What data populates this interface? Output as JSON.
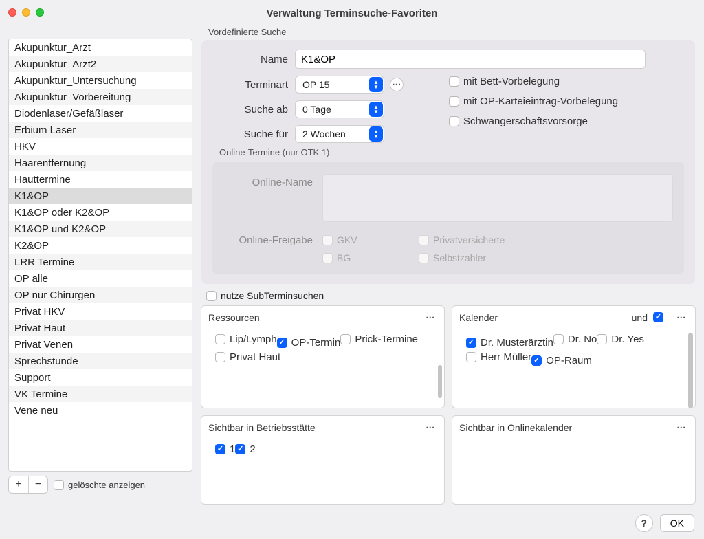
{
  "window": {
    "title": "Verwaltung Terminsuche-Favoriten"
  },
  "sidebar": {
    "items": [
      "Akupunktur_Arzt",
      "Akupunktur_Arzt2",
      "Akupunktur_Untersuchung",
      "Akupunktur_Vorbereitung",
      "Diodenlaser/Gefäßlaser",
      "Erbium Laser",
      "HKV",
      "Haarentfernung",
      "Hauttermine",
      "K1&OP",
      "K1&OP oder K2&OP",
      "K1&OP und K2&OP",
      "K2&OP",
      "LRR Termine",
      "OP alle",
      "OP nur Chirurgen",
      "Privat HKV",
      "Privat Haut",
      "Privat Venen",
      "Sprechstunde",
      "Support",
      "VK Termine",
      "Vene neu"
    ],
    "selected_index": 9,
    "add_label": "+",
    "remove_label": "−",
    "show_deleted_label": "gelöschte anzeigen"
  },
  "predef": {
    "section_title": "Vordefinierte Suche",
    "labels": {
      "name": "Name",
      "terminart": "Terminart",
      "suche_ab": "Suche ab",
      "suche_fuer": "Suche für"
    },
    "values": {
      "name": "K1&OP",
      "terminart": "OP 15",
      "suche_ab": "0 Tage",
      "suche_fuer": "2 Wochen"
    },
    "checks": {
      "bett": "mit Bett-Vorbelegung",
      "opkartei": "mit OP-Karteieintrag-Vorbelegung",
      "schwanger": "Schwangerschaftsvorsorge"
    }
  },
  "online": {
    "section_title": "Online-Termine (nur OTK 1)",
    "labels": {
      "online_name": "Online-Name",
      "online_freigabe": "Online-Freigabe"
    },
    "freigabe_options": {
      "gkv": "GKV",
      "privat": "Privatversicherte",
      "bg": "BG",
      "selbst": "Selbstzahler"
    }
  },
  "subcheck_label": "nutze SubTerminsuchen",
  "panels": {
    "ressourcen": {
      "title": "Ressourcen",
      "items": [
        {
          "label": "Lip/Lymph",
          "checked": false
        },
        {
          "label": "OP-Termin",
          "checked": true
        },
        {
          "label": "Prick-Termine",
          "checked": false
        },
        {
          "label": "Privat Haut",
          "checked": false
        }
      ]
    },
    "kalender": {
      "title": "Kalender",
      "und_label": "und",
      "und_checked": true,
      "items": [
        {
          "label": "Dr. Musterärztin",
          "checked": true
        },
        {
          "label": "Dr. No",
          "checked": false
        },
        {
          "label": "Dr. Yes",
          "checked": false
        },
        {
          "label": "Herr Müller",
          "checked": false
        },
        {
          "label": "OP-Raum",
          "checked": true
        }
      ]
    },
    "betriebsstaette": {
      "title": "Sichtbar in Betriebsstätte",
      "items": [
        {
          "label": "1",
          "checked": true
        },
        {
          "label": "2",
          "checked": true
        }
      ]
    },
    "onlinekalender": {
      "title": "Sichtbar in Onlinekalender"
    }
  },
  "buttons": {
    "help": "?",
    "ok": "OK"
  }
}
